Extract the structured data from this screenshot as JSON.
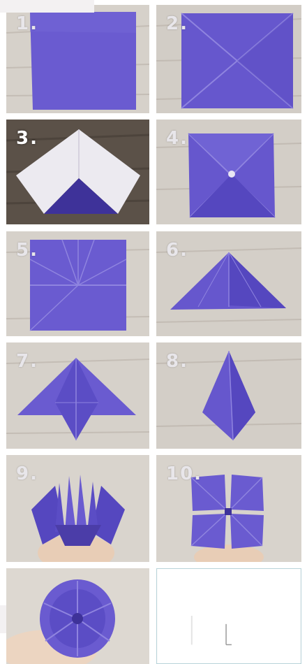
{
  "steps": [
    {
      "label": "1."
    },
    {
      "label": "2."
    },
    {
      "label": "3."
    },
    {
      "label": "4."
    },
    {
      "label": "5."
    },
    {
      "label": "6."
    },
    {
      "label": "7."
    },
    {
      "label": "8."
    },
    {
      "label": "9."
    },
    {
      "label": "10."
    }
  ],
  "colors": {
    "paper_purple": "#6a5bd0",
    "paper_purple_dark": "#4b3da8",
    "paper_white": "#eceaf0",
    "wood_light": "#d7d2cb",
    "wood_dark": "#5b5148",
    "crease": "#8f84df"
  }
}
